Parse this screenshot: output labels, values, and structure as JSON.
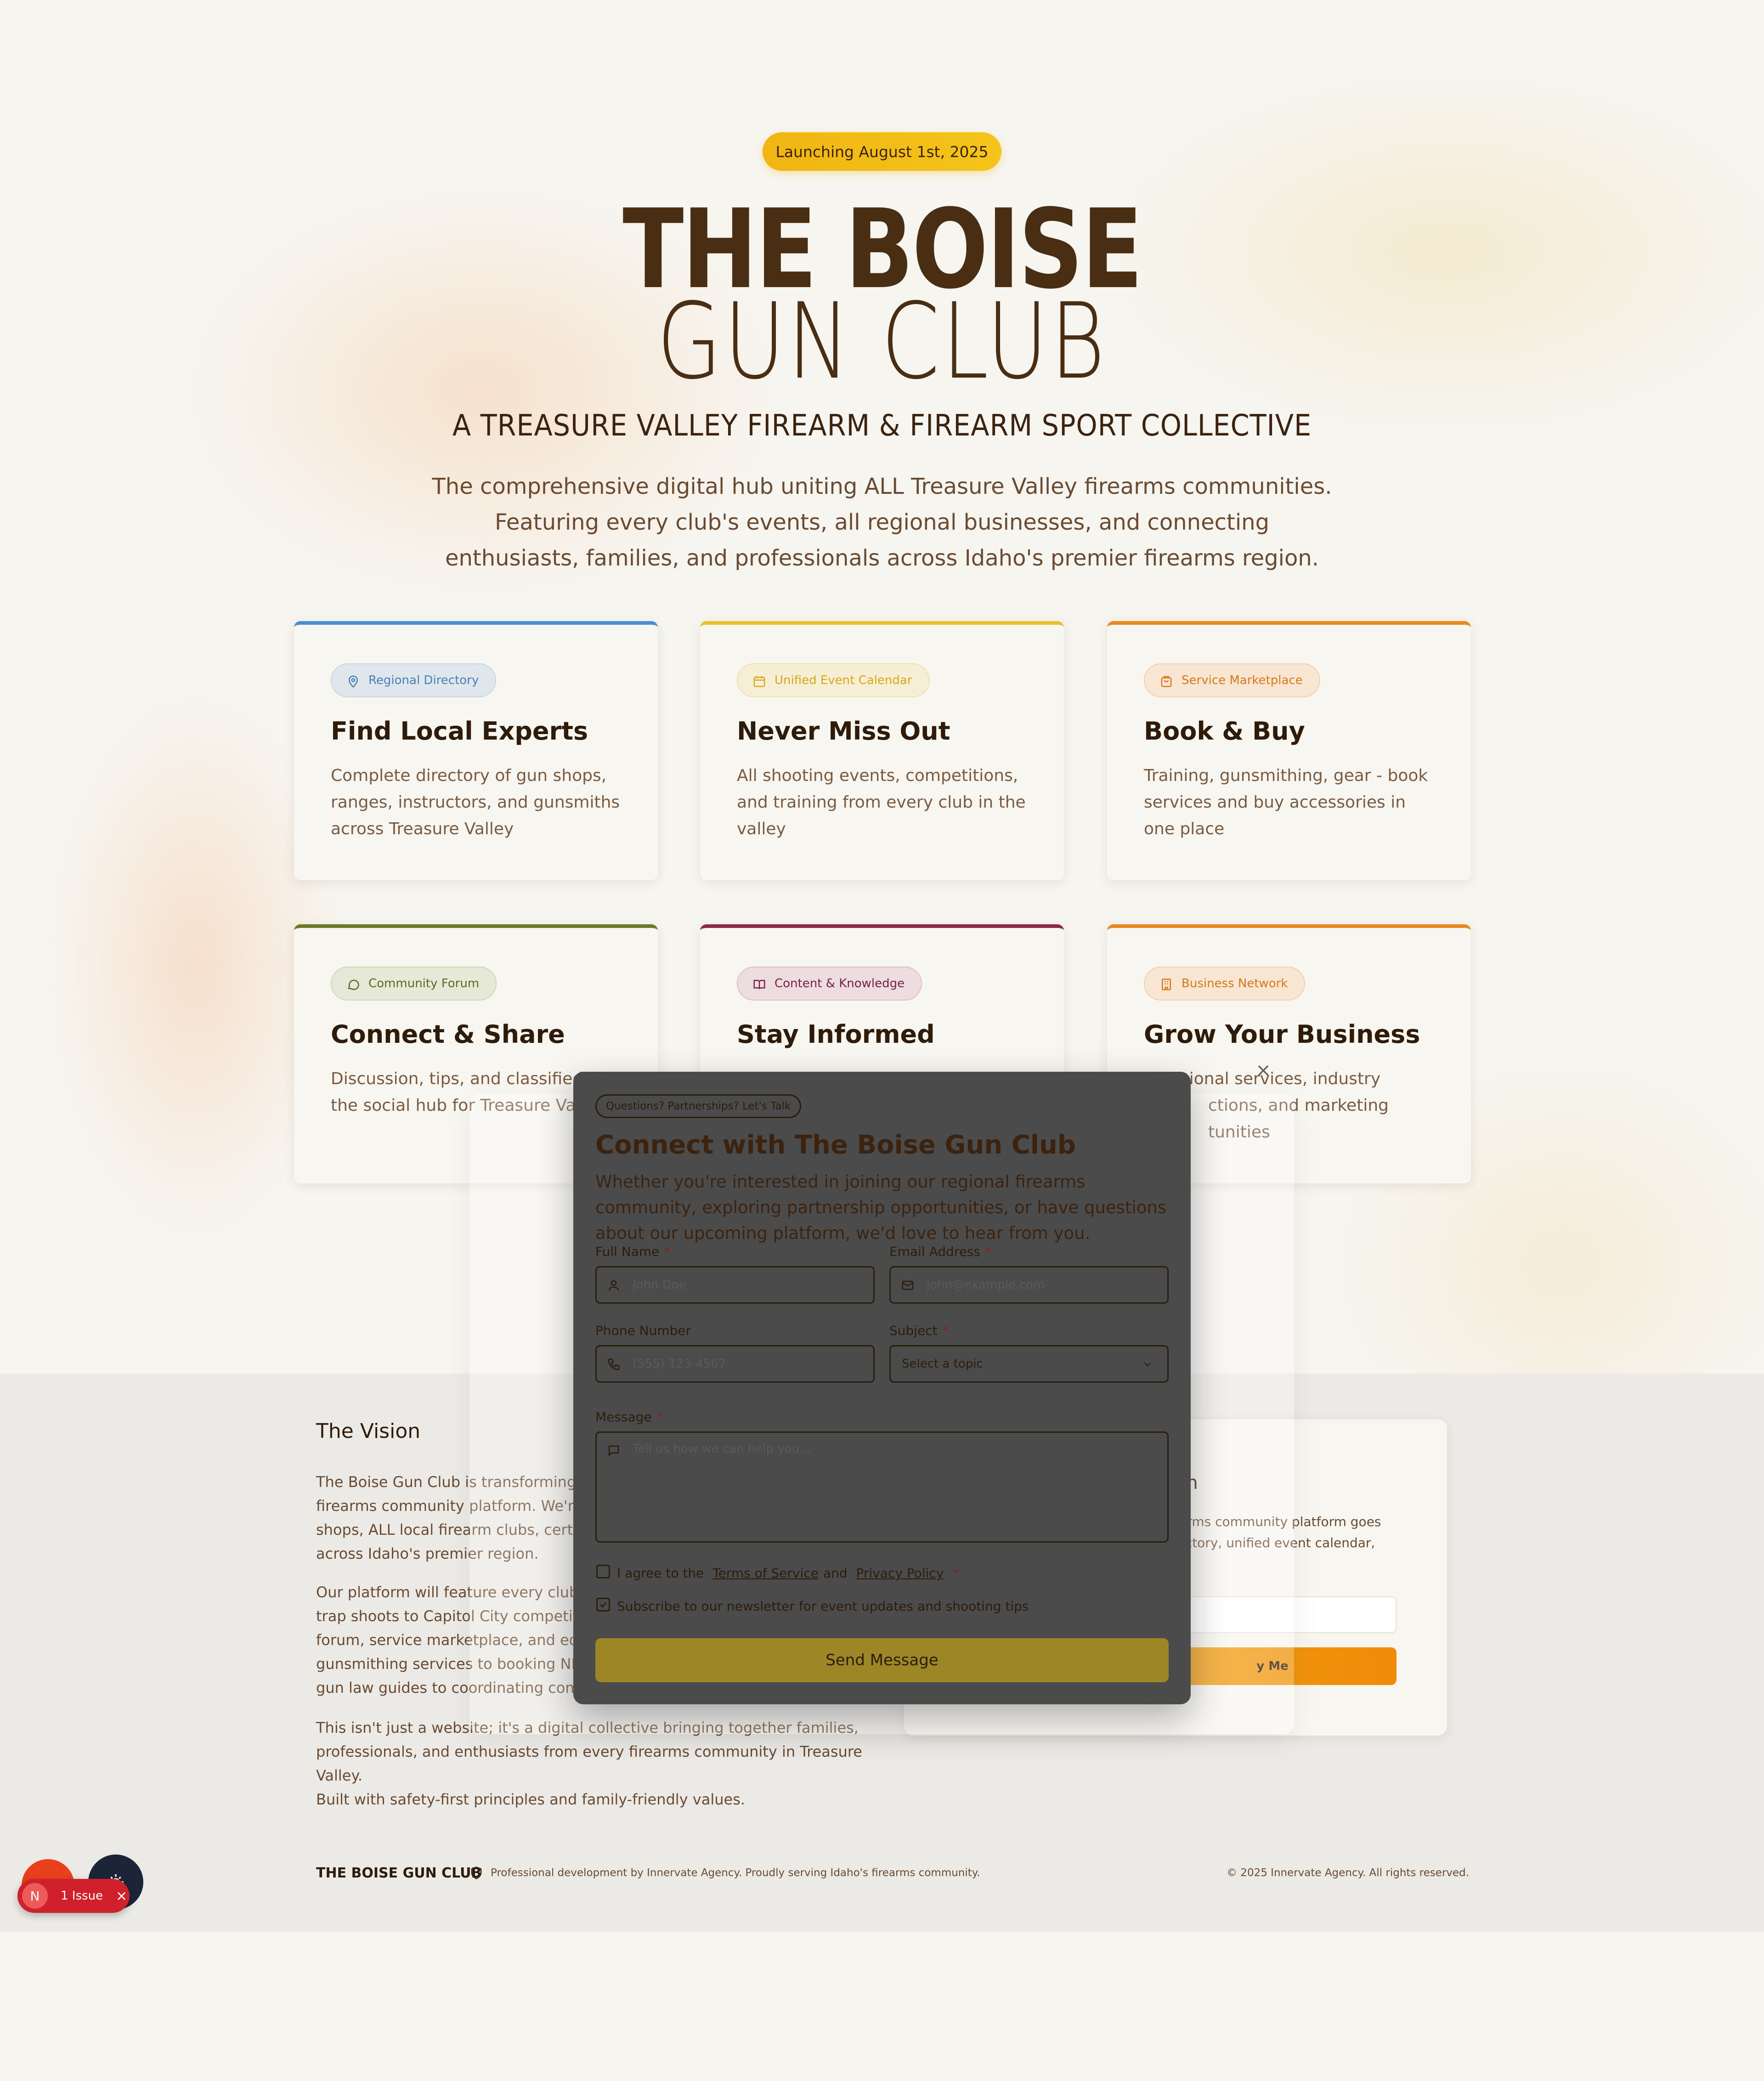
{
  "hero": {
    "launch_badge": "Launching August 1st, 2025",
    "title_line1": "THE BOISE",
    "title_line2": "GUN CLUB",
    "tagline": "A TREASURE VALLEY FIREARM & FIREARM SPORT COLLECTIVE",
    "intro": "The comprehensive digital hub uniting ALL Treasure Valley firearms communities. Featuring every club's events, all regional businesses, and connecting enthusiasts, families, and professionals across Idaho's premier firearms region."
  },
  "features": [
    {
      "badge": "Regional Directory",
      "icon": "map-pin-icon",
      "title": "Find Local Experts",
      "desc": "Complete directory of gun shops, ranges, instructors, and gunsmiths across Treasure Valley",
      "accent": "#4a90d0"
    },
    {
      "badge": "Unified Event Calendar",
      "icon": "calendar-icon",
      "title": "Never Miss Out",
      "desc": "All shooting events, competitions, and training from every club in the valley",
      "accent": "#e8c030"
    },
    {
      "badge": "Service Marketplace",
      "icon": "shopping-bag-icon",
      "title": "Book & Buy",
      "desc": "Training, gunsmithing, gear - book services and buy accessories in one place",
      "accent": "#e88a20"
    },
    {
      "badge": "Community Forum",
      "icon": "chat-bubble-icon",
      "title": "Connect & Share",
      "desc": "Discussion, tips, and classifieds - the social hub for Treasure Valley",
      "accent": "#6a7a28"
    },
    {
      "badge": "Content & Knowledge",
      "icon": "book-icon",
      "title": "Stay Informed",
      "desc": "",
      "accent": "#8a2a48"
    },
    {
      "badge": "Business Network",
      "icon": "building-icon",
      "title": "Grow Your Business",
      "desc_visible": "sional services, industry",
      "desc_visible2": "ctions, and marketing",
      "desc_visible3": "tunities",
      "accent": "#e88a20"
    }
  ],
  "vision": {
    "heading": "The Vision",
    "p1": "The Boise Gun Club is transforming into\nfirearms community platform. We're bu\nshops, ALL local firearm clubs, certified\nacross Idaho's premier region.",
    "p2": "Our platform will feature every club's ev\ntrap shoots to Capitol City competitions\nforum, service marketplace, and educat\ngunsmithing services to booking NRA-c\ngun law guides to coordinating commun",
    "p3": "This isn't just a website; it's a digital collective bringing together families,\nprofessionals, and enthusiasts from every firearms community in Treasure Valley.\nBuilt with safety-first principles and family-friendly values."
  },
  "notify": {
    "heading_fragment": "nch",
    "desc_fragment": "r firearms community platform goes\ne directory, unified event calendar,",
    "button_fragment": "y Me"
  },
  "modal": {
    "pill": "Questions? Partnerships? Let's Talk",
    "title": "Connect with The Boise Gun Club",
    "desc": "Whether you're interested in joining our regional firearms community, exploring partnership opportunities, or have questions about our upcoming platform, we'd love to hear from you.",
    "full_name_label": "Full Name",
    "full_name_placeholder": "John Doe",
    "email_label": "Email Address",
    "email_placeholder": "john@example.com",
    "phone_label": "Phone Number",
    "phone_placeholder": "(555) 123-4567",
    "subject_label": "Subject",
    "subject_value": "Select a topic",
    "message_label": "Message",
    "message_placeholder": "Tell us how we can help you...",
    "required_mark": "*",
    "terms_prefix": "I agree to the",
    "terms_link": "Terms of Service",
    "terms_and": "and",
    "privacy_link": "Privacy Policy",
    "newsletter": "Subscribe to our newsletter for event updates and shooting tips",
    "send": "Send Message",
    "close": "×"
  },
  "footer": {
    "brand": "THE BOISE GUN CLUB",
    "credit": "Professional development by Innervate Agency. Proudly serving Idaho's firearms community.",
    "copyright": "© 2025 Innervate Agency. All rights reserved."
  },
  "devtools": {
    "issue_count": "1 Issue",
    "issue_initial": "N"
  }
}
